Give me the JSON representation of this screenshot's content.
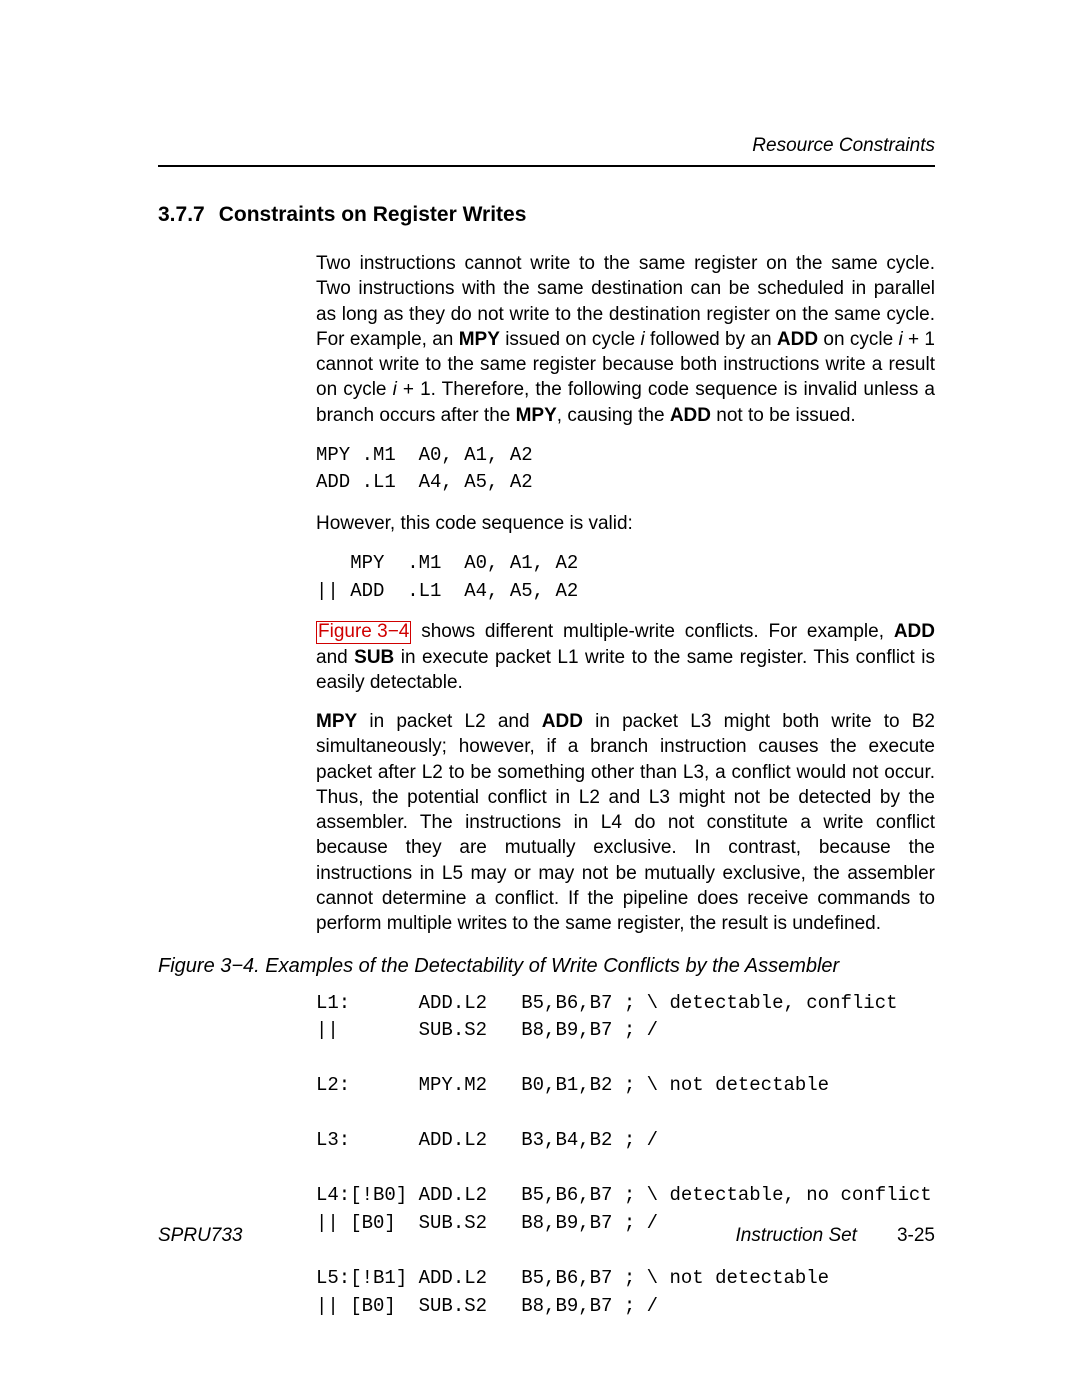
{
  "running_head": "Resource Constraints",
  "section": {
    "number": "3.7.7",
    "title": "Constraints on Register Writes"
  },
  "para1_a": "Two instructions cannot write to the same register on the same cycle. Two instructions with the same destination can be scheduled in parallel as long as they do not write to the destination register on the same cycle. For example, an ",
  "mpy": "MPY",
  "para1_b": " issued on cycle ",
  "i1": "i",
  "para1_c": " followed by an ",
  "add": "ADD",
  "para1_d": " on cycle ",
  "i2": "i",
  "plus1a": " + 1 cannot write to the same register because both instructions write a result on cycle ",
  "i3": "i",
  "plus1b": " + 1. Therefore, the following code sequence is invalid unless a branch occurs after the ",
  "mpy2": "MPY",
  "para1_e": ", causing the ",
  "add2": "ADD",
  "para1_f": " not to be issued.",
  "code1": "MPY .M1  A0, A1, A2\nADD .L1  A4, A5, A2",
  "para2": "However, this code sequence is valid:",
  "code2": "   MPY  .M1  A0, A1, A2\n|| ADD  .L1  A4, A5, A2",
  "fig_link": "Figure 3−4",
  "para3_a": " shows different multiple-write conflicts. For example, ",
  "add3": "ADD",
  "para3_b": " and ",
  "sub": "SUB",
  "para3_c": " in execute packet L1 write to the same register. This conflict is easily detectable.",
  "mpy3": "MPY",
  "para4_a": " in packet L2 and ",
  "add4": "ADD",
  "para4_b": " in packet L3 might both write to B2 simultaneously; however, if a branch instruction causes the execute packet after L2 to be something other than L3, a conflict would not occur. Thus, the potential conflict in L2 and L3 might not be detected by the assembler. The instructions in L4 do not constitute a write conflict because they are mutually exclusive. In contrast, because the instructions in L5 may or may not be mutually exclusive, the assembler cannot determine a conflict. If the pipeline does receive commands to perform multiple writes to the same register, the result is undefined.",
  "figure_caption": "Figure 3−4.  Examples of the Detectability of Write Conflicts by the Assembler",
  "code3": "L1:      ADD.L2   B5,B6,B7 ; \\ detectable, conflict\n||       SUB.S2   B8,B9,B7 ; /\n\nL2:      MPY.M2   B0,B1,B2 ; \\ not detectable\n\nL3:      ADD.L2   B3,B4,B2 ; /\n\nL4:[!B0] ADD.L2   B5,B6,B7 ; \\ detectable, no conflict\n|| [B0]  SUB.S2   B8,B9,B7 ; /\n\nL5:[!B1] ADD.L2   B5,B6,B7 ; \\ not detectable\n|| [B0]  SUB.S2   B8,B9,B7 ; /",
  "footer": {
    "doc_id": "SPRU733",
    "chapter": "Instruction Set",
    "page": "3-25"
  }
}
